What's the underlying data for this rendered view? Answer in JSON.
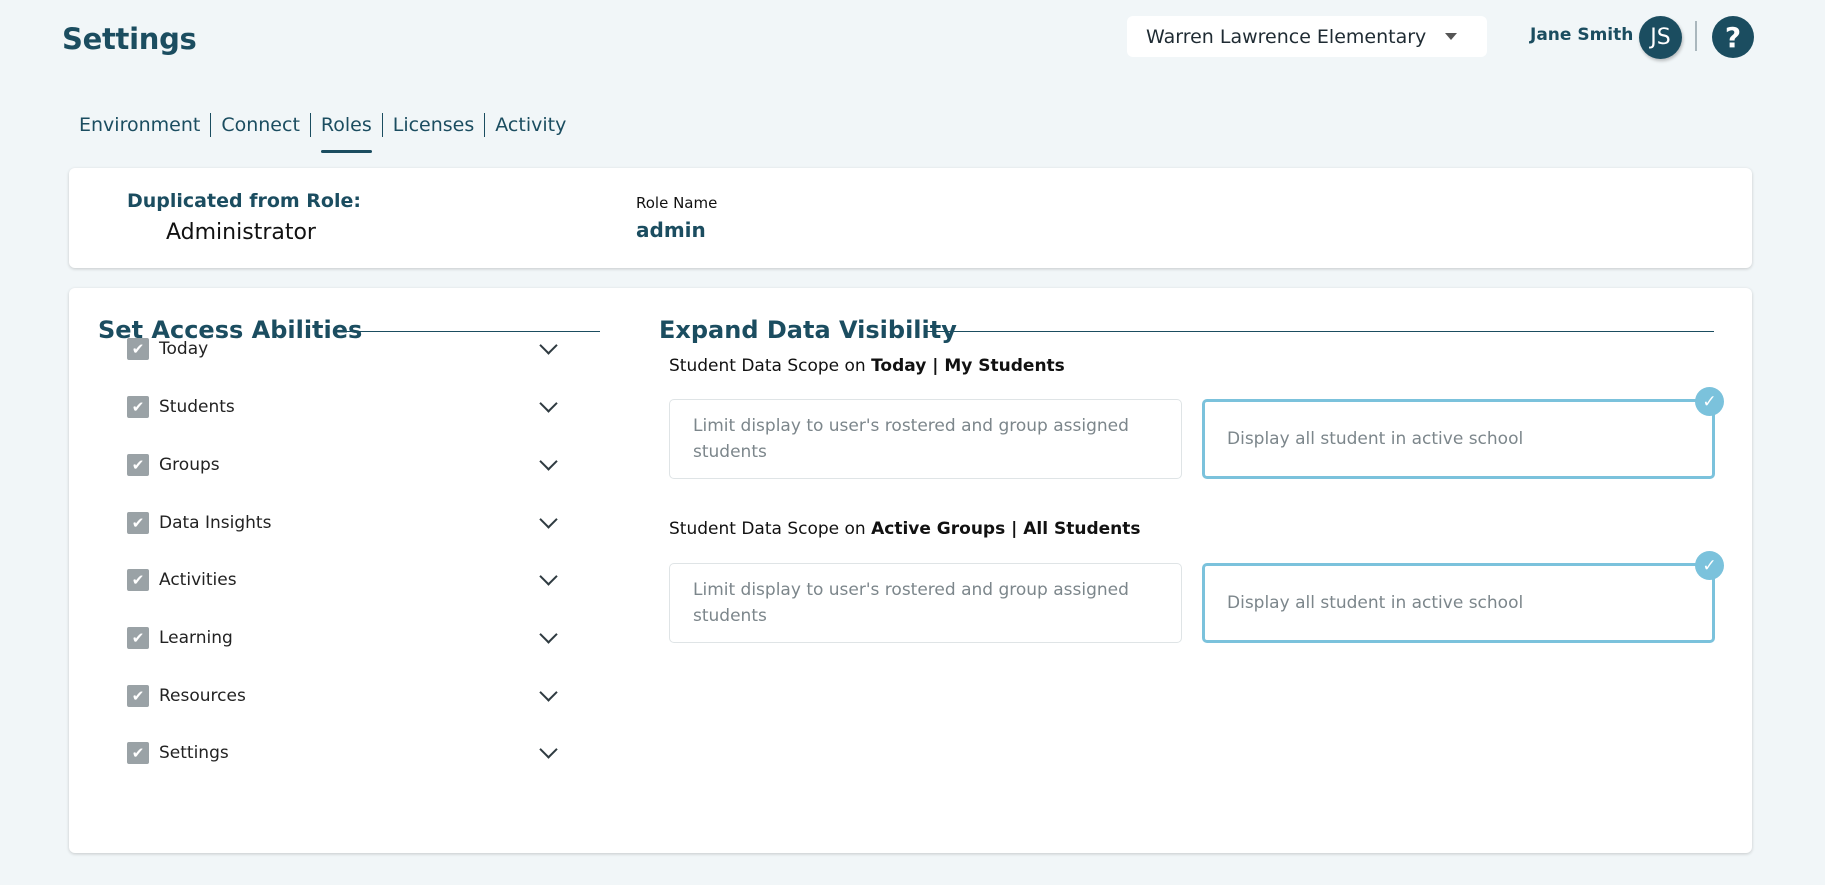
{
  "header": {
    "title": "Settings",
    "school": "Warren Lawrence Elementary",
    "user_name": "Jane Smith",
    "avatar_initials": "JS",
    "help_glyph": "?"
  },
  "tabs": [
    {
      "label": "Environment",
      "active": false
    },
    {
      "label": "Connect",
      "active": false
    },
    {
      "label": "Roles",
      "active": true
    },
    {
      "label": "Licenses",
      "active": false
    },
    {
      "label": "Activity",
      "active": false
    }
  ],
  "role": {
    "duplicated_label": "Duplicated from Role:",
    "duplicated_value": "Administrator",
    "name_label": "Role Name",
    "name_value": "admin"
  },
  "access": {
    "title": "Set Access Abilities",
    "items": [
      {
        "label": "Today",
        "checked": true
      },
      {
        "label": "Students",
        "checked": true
      },
      {
        "label": "Groups",
        "checked": true
      },
      {
        "label": "Data Insights",
        "checked": true
      },
      {
        "label": "Activities",
        "checked": true
      },
      {
        "label": "Learning",
        "checked": true
      },
      {
        "label": "Resources",
        "checked": true
      },
      {
        "label": "Settings",
        "checked": true
      }
    ]
  },
  "visibility": {
    "title": "Expand Data Visibility",
    "scopes": [
      {
        "prefix": "Student Data Scope on ",
        "context": "Today | My Students",
        "option_limited": "Limit display to user's rostered and group assigned students",
        "option_all": "Display all student in active school",
        "selected": "all"
      },
      {
        "prefix": "Student Data Scope on ",
        "context": "Active Groups | All Students",
        "option_limited": "Limit display to user's rostered and group assigned students",
        "option_all": "Display all student in active school",
        "selected": "all"
      }
    ]
  },
  "colors": {
    "brand": "#1b4d60",
    "accent": "#7bc2dc",
    "background": "#f1f6f8",
    "checkbox": "#9aa2a6"
  }
}
